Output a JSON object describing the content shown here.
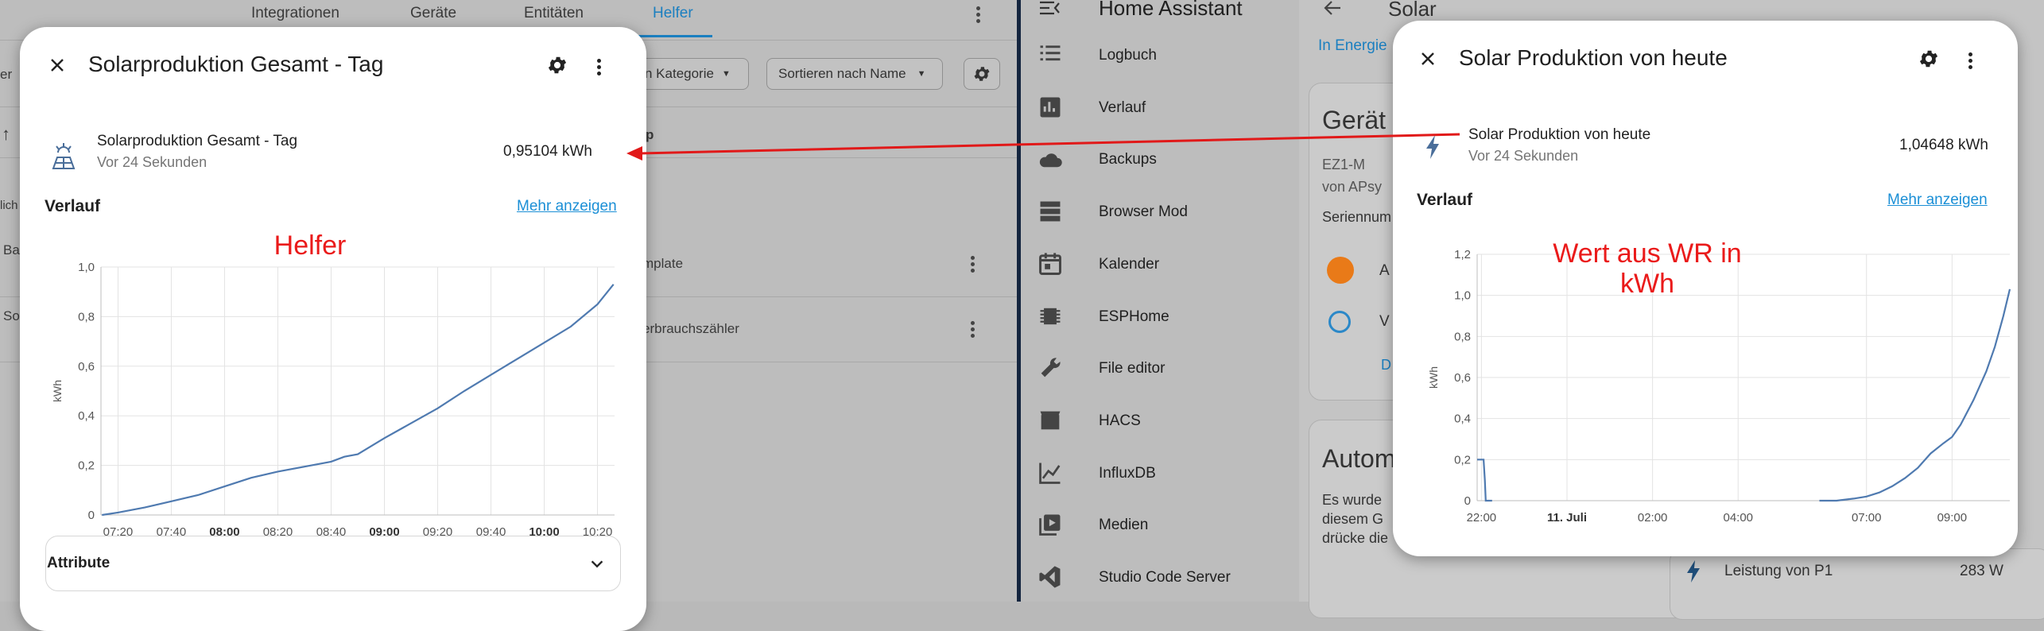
{
  "left_bg": {
    "tabs": [
      "Integrationen",
      "Geräte",
      "Entitäten",
      "Helfer"
    ],
    "filter_category": "n Kategorie",
    "sort": "Sortieren nach Name",
    "col_header": "p",
    "left_cut": "er",
    "left_col": "lich",
    "row_texts": [
      "mplate",
      "erbrauchszähler"
    ],
    "row_stubs": [
      "Ba",
      "So"
    ]
  },
  "dialog_left": {
    "title": "Solarproduktion Gesamt - Tag",
    "entity_name": "Solarproduktion Gesamt - Tag",
    "entity_sub": "Vor 24 Sekunden",
    "entity_value": "0,95104 kWh",
    "section": "Verlauf",
    "more": "Mehr anzeigen",
    "attributes": "Attribute",
    "annotation": "Helfer"
  },
  "dialog_right": {
    "title": "Solar Produktion von heute",
    "entity_name": "Solar Produktion von heute",
    "entity_sub": "Vor 24 Sekunden",
    "entity_value": "1,04648 kWh",
    "section": "Verlauf",
    "more": "Mehr anzeigen",
    "annotation_line1": "Wert aus WR in",
    "annotation_line2": "kWh"
  },
  "sidebar": {
    "app_title": "Home Assistant",
    "items": [
      {
        "label": "Logbuch",
        "icon": "list-icon"
      },
      {
        "label": "Verlauf",
        "icon": "chart-box-icon"
      },
      {
        "label": "Backups",
        "icon": "cloud-icon"
      },
      {
        "label": "Browser Mod",
        "icon": "server-icon"
      },
      {
        "label": "Kalender",
        "icon": "calendar-icon"
      },
      {
        "label": "ESPHome",
        "icon": "chip-icon"
      },
      {
        "label": "File editor",
        "icon": "wrench-icon"
      },
      {
        "label": "HACS",
        "icon": "hacs-store-icon"
      },
      {
        "label": "InfluxDB",
        "icon": "chart-line-icon"
      },
      {
        "label": "Medien",
        "icon": "play-box-icon"
      },
      {
        "label": "Studio Code Server",
        "icon": "vscode-icon"
      }
    ]
  },
  "right_bg": {
    "page_title": "Solar",
    "breadcrumb": "In Energie",
    "devices_heading": "Gerät",
    "device_model": "EZ1-M",
    "device_by": "von APsy",
    "serial": "Seriennum",
    "row_a": "A",
    "row_v": "V",
    "row_d": "D",
    "autom_heading": "Autom",
    "autom_text": [
      "Es wurde",
      "diesem G",
      "drücke die"
    ],
    "power_label": "Leistung von P1",
    "power_value": "283 W"
  },
  "chart_data": [
    {
      "type": "line",
      "ylabel": "kWh",
      "ylim": [
        0,
        1.0
      ],
      "y_ticks": [
        "0",
        "0,2",
        "0,4",
        "0,6",
        "0,8",
        "1,0"
      ],
      "x_ticks": [
        "07:20",
        "07:40",
        "08:00",
        "08:20",
        "08:40",
        "09:00",
        "09:20",
        "09:40",
        "10:00",
        "10:20"
      ],
      "x_ticks_bold": [
        "08:00",
        "09:00",
        "10:00"
      ],
      "x": [
        "07:14",
        "07:20",
        "07:30",
        "07:40",
        "07:50",
        "08:00",
        "08:10",
        "08:20",
        "08:30",
        "08:40",
        "08:45",
        "08:50",
        "09:00",
        "09:10",
        "09:20",
        "09:30",
        "09:40",
        "09:50",
        "10:00",
        "10:10",
        "10:20",
        "10:26"
      ],
      "values": [
        0.0,
        0.01,
        0.03,
        0.055,
        0.08,
        0.115,
        0.15,
        0.175,
        0.195,
        0.215,
        0.235,
        0.245,
        0.31,
        0.37,
        0.43,
        0.5,
        0.565,
        0.63,
        0.695,
        0.76,
        0.85,
        0.93
      ]
    },
    {
      "type": "line",
      "ylabel": "kWh",
      "ylim": [
        0,
        1.2
      ],
      "y_ticks": [
        "0",
        "0,2",
        "0,4",
        "0,6",
        "0,8",
        "1,0",
        "1,2"
      ],
      "x_ticks": [
        "22:00",
        "11. Juli",
        "02:00",
        "04:00",
        "07:00",
        "09:00"
      ],
      "x_ticks_bold": [
        "11. Juli"
      ],
      "segments": [
        {
          "x": [
            21.9,
            22.0,
            22.05,
            22.08,
            22.1,
            22.25
          ],
          "values": [
            0.2,
            0.2,
            0.2,
            0.1,
            0.0,
            0.0
          ]
        },
        {
          "x": [
            5.9,
            6.3,
            6.7,
            7.0,
            7.3,
            7.6,
            7.9,
            8.2,
            8.5,
            8.8,
            9.0,
            9.2,
            9.5,
            9.8,
            10.0,
            10.2,
            10.35
          ],
          "values": [
            0.0,
            0.0,
            0.01,
            0.02,
            0.04,
            0.07,
            0.11,
            0.16,
            0.23,
            0.28,
            0.31,
            0.37,
            0.49,
            0.63,
            0.75,
            0.9,
            1.03
          ]
        }
      ]
    }
  ]
}
